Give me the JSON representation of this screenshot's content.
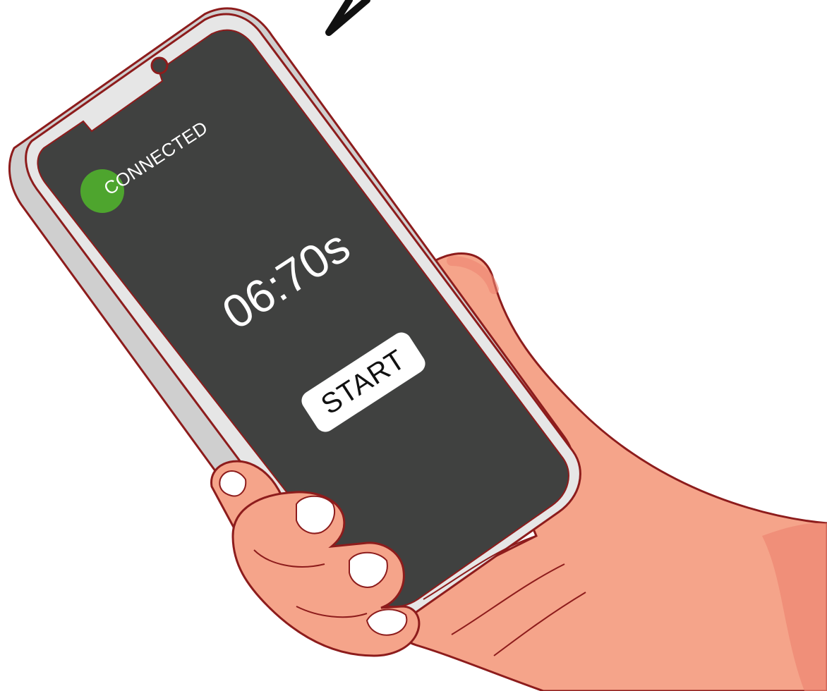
{
  "status": {
    "label": "CONNECTED",
    "color": "#4ea52e"
  },
  "timer": {
    "value": "06:70s"
  },
  "controls": {
    "start_label": "START"
  },
  "colors": {
    "screen": "#404140",
    "phone_frame": "#e6e6e6",
    "outline": "#8d1c1c",
    "skin": "#f5a48a",
    "skin_shadow": "#ee8672",
    "nail": "#ffffff"
  }
}
